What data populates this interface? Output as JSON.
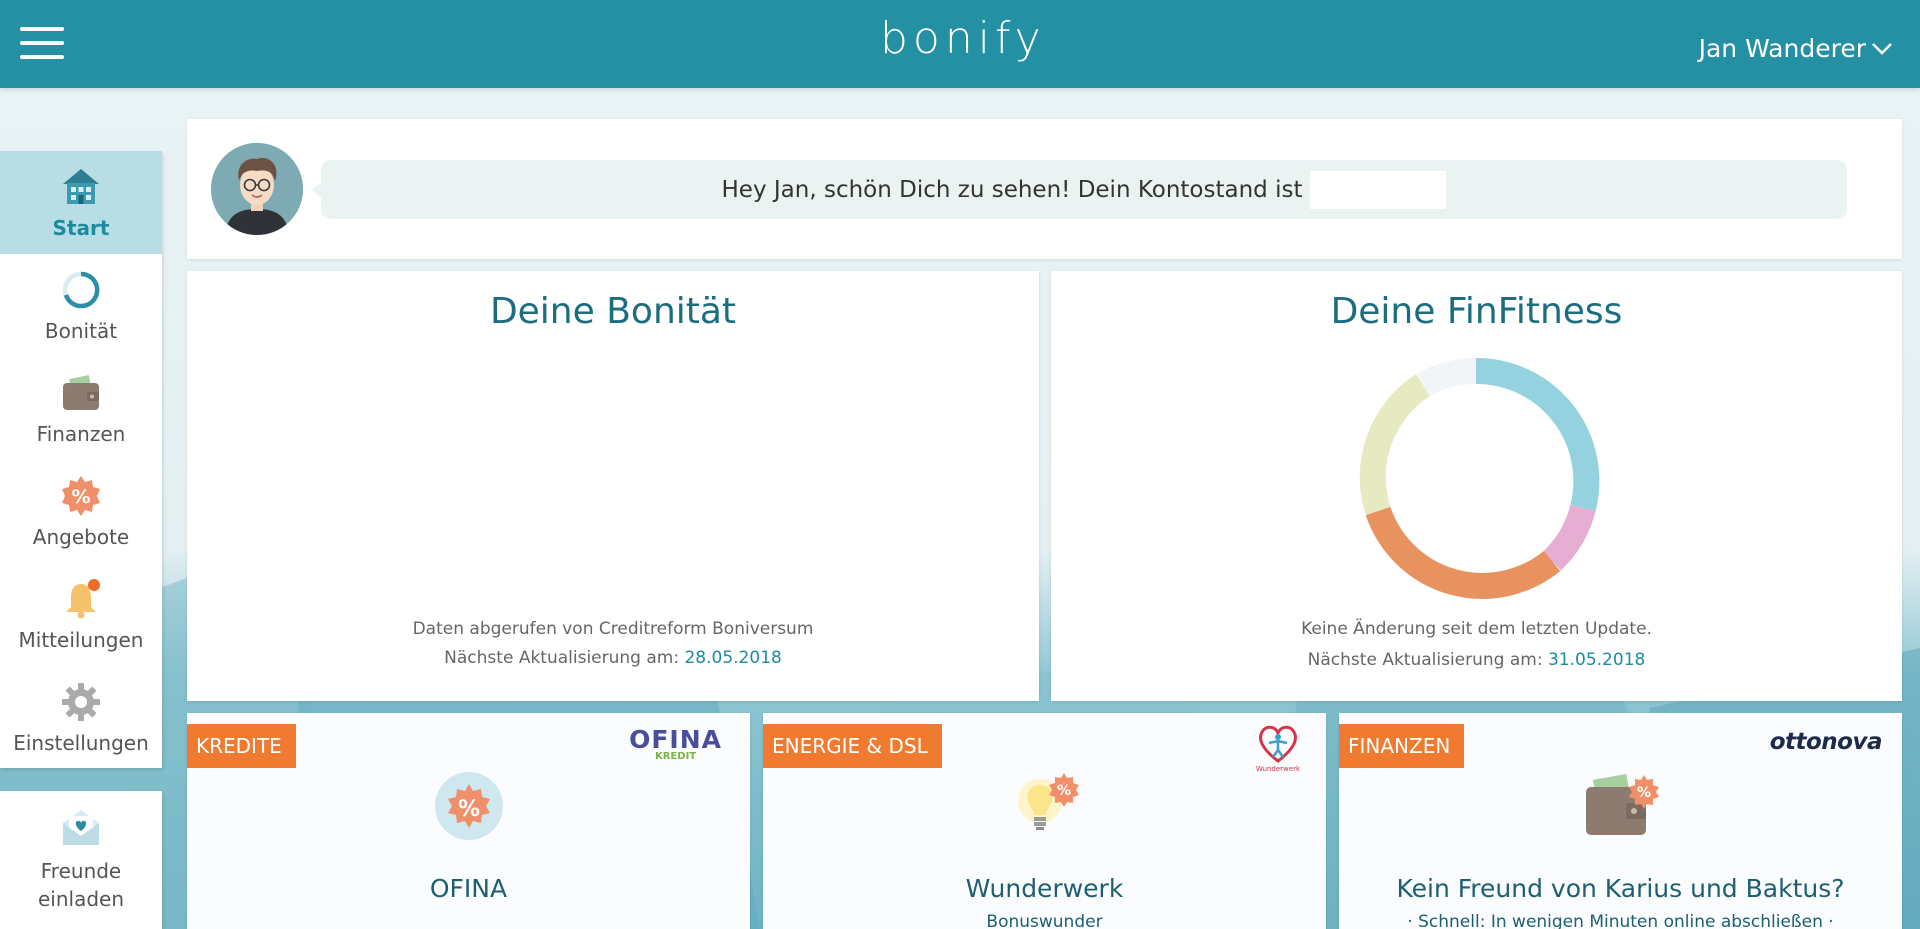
{
  "header": {
    "logo_text": "bonify",
    "user_name": "Jan Wanderer"
  },
  "sidebar": {
    "items": [
      {
        "label": "Start",
        "icon": "house-icon",
        "active": true
      },
      {
        "label": "Bonität",
        "icon": "bonitaet-ring-icon",
        "active": false
      },
      {
        "label": "Finanzen",
        "icon": "wallet-icon",
        "active": false
      },
      {
        "label": "Angebote",
        "icon": "percent-badge-icon",
        "active": false
      },
      {
        "label": "Mitteilungen",
        "icon": "bell-icon",
        "active": false
      },
      {
        "label": "Einstellungen",
        "icon": "gear-icon",
        "active": false
      }
    ],
    "invite": {
      "label_line1": "Freunde",
      "label_line2": "einladen",
      "icon": "envelope-heart-icon"
    }
  },
  "greeting": {
    "text": "Hey Jan, schön Dich zu sehen! Dein Kontostand ist"
  },
  "bonitaet": {
    "title": "Deine Bonität",
    "source": "Daten abgerufen von Creditreform Boniversum",
    "next_update_label": "Nächste Aktualisierung am:",
    "next_update_date": "28.05.2018"
  },
  "finfitness": {
    "title": "Deine FinFitness",
    "status": "Keine Änderung seit dem letzten Update.",
    "next_update_label": "Nächste Aktualisierung am:",
    "next_update_date": "31.05.2018",
    "colors": [
      "#93d2de",
      "#e5aed2",
      "#e8925f",
      "#e7e9c1",
      "#f1f5f8"
    ]
  },
  "offers": [
    {
      "tag": "KREDITE",
      "partner_line1": "OFINA",
      "partner_line2": "KREDIT",
      "title": "OFINA",
      "subtitle": "",
      "icon": "percent-badge-icon"
    },
    {
      "tag": "ENERGIE & DSL",
      "partner_line1": "Wunderwerk",
      "partner_line2": "",
      "title": "Wunderwerk",
      "subtitle": "Bonuswunder",
      "icon": "lightbulb-percent-icon"
    },
    {
      "tag": "FINANZEN",
      "partner_line1": "ottonova",
      "partner_line2": "",
      "title": "Kein Freund von Karius und Baktus?",
      "subtitle": "· Schnell: In wenigen Minuten online abschließen ·",
      "icon": "wallet-percent-icon"
    }
  ]
}
